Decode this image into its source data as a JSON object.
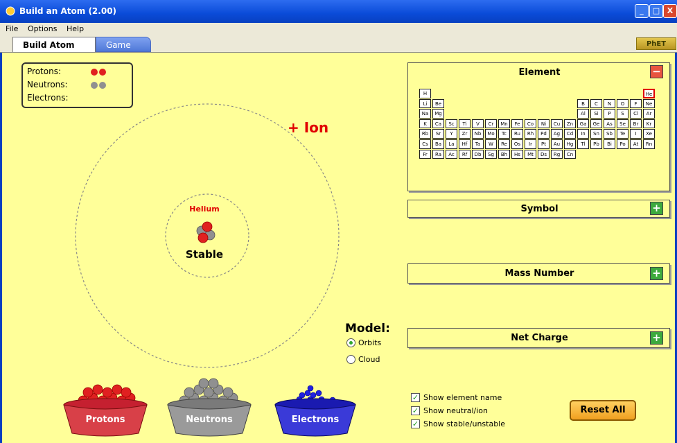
{
  "window": {
    "title": "Build an Atom (2.00)",
    "minimize": "_",
    "maximize": "□",
    "close": "X"
  },
  "menu": {
    "file": "File",
    "options": "Options",
    "help": "Help"
  },
  "tabs": [
    {
      "label": "Build Atom",
      "active": true
    },
    {
      "label": "Game",
      "active": false
    }
  ],
  "logo": "PhET",
  "counts": {
    "protons_label": "Protons:",
    "neutrons_label": "Neutrons:",
    "electrons_label": "Electrons:",
    "protons": 2,
    "neutrons": 2,
    "electrons": 0
  },
  "atom": {
    "ion_label": "+ Ion",
    "element_name": "Helium",
    "stability": "Stable"
  },
  "panels": {
    "element": {
      "title": "Element",
      "button": "−",
      "expanded": true
    },
    "symbol": {
      "title": "Symbol",
      "button": "+",
      "expanded": false
    },
    "mass_number": {
      "title": "Mass Number",
      "button": "+",
      "expanded": false
    },
    "net_charge": {
      "title": "Net Charge",
      "button": "+",
      "expanded": false
    }
  },
  "periodic_table": {
    "selected": "He",
    "rows": [
      [
        "H",
        "",
        "",
        "",
        "",
        "",
        "",
        "",
        "",
        "",
        "",
        "",
        "",
        "",
        "",
        "",
        "",
        "He"
      ],
      [
        "Li",
        "Be",
        "",
        "",
        "",
        "",
        "",
        "",
        "",
        "",
        "",
        "",
        "B",
        "C",
        "N",
        "O",
        "F",
        "Ne"
      ],
      [
        "Na",
        "Mg",
        "",
        "",
        "",
        "",
        "",
        "",
        "",
        "",
        "",
        "",
        "Al",
        "Si",
        "P",
        "S",
        "Cl",
        "Ar"
      ],
      [
        "K",
        "Ca",
        "Sc",
        "Ti",
        "V",
        "Cr",
        "Mn",
        "Fe",
        "Co",
        "Ni",
        "Cu",
        "Zn",
        "Ga",
        "Ge",
        "As",
        "Se",
        "Br",
        "Kr"
      ],
      [
        "Rb",
        "Sr",
        "Y",
        "Zr",
        "Nb",
        "Mo",
        "Tc",
        "Ru",
        "Rh",
        "Pd",
        "Ag",
        "Cd",
        "In",
        "Sn",
        "Sb",
        "Te",
        "I",
        "Xe"
      ],
      [
        "Cs",
        "Ba",
        "La",
        "Hf",
        "Ta",
        "W",
        "Re",
        "Os",
        "Ir",
        "Pt",
        "Au",
        "Hg",
        "Tl",
        "Pb",
        "Bi",
        "Po",
        "At",
        "Rn"
      ],
      [
        "Fr",
        "Ra",
        "Ac",
        "Rf",
        "Db",
        "Sg",
        "Bh",
        "Hs",
        "Mt",
        "Ds",
        "Rg",
        "Cn",
        "",
        "",
        "",
        "",
        "",
        ""
      ]
    ]
  },
  "model": {
    "title": "Model:",
    "options": [
      {
        "label": "Orbits",
        "selected": true
      },
      {
        "label": "Cloud",
        "selected": false
      }
    ]
  },
  "checkboxes": [
    {
      "label": "Show element name",
      "checked": true
    },
    {
      "label": "Show neutral/ion",
      "checked": true
    },
    {
      "label": "Show stable/unstable",
      "checked": true
    }
  ],
  "reset_label": "Reset All",
  "buckets": [
    {
      "label": "Protons",
      "color": "#e02020"
    },
    {
      "label": "Neutrons",
      "color": "#909090"
    },
    {
      "label": "Electrons",
      "color": "#2020e0"
    }
  ],
  "colors": {
    "background": "#ffff99",
    "proton": "#e02020",
    "neutron": "#909090",
    "electron": "#2020e0",
    "ion_text": "#e00000",
    "title_bar": "#0a4bd8"
  }
}
